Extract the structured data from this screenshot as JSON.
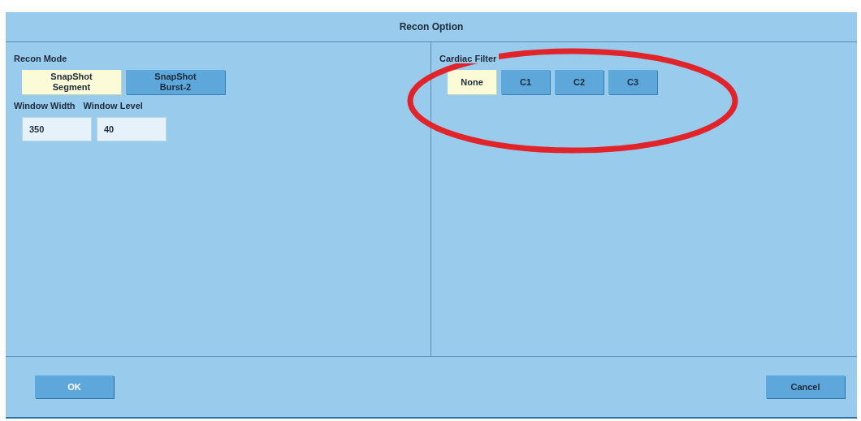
{
  "window": {
    "title": "Recon Option"
  },
  "recon_mode": {
    "label": "Recon Mode",
    "options": [
      {
        "label": "SnapShot\nSegment",
        "selected": true
      },
      {
        "label": "SnapShot\nBurst-2",
        "selected": false
      }
    ]
  },
  "fields": [
    {
      "label": "Window Width",
      "value": "350"
    },
    {
      "label": "Window Level",
      "value": "40"
    }
  ],
  "cardiac_filter": {
    "label": "Cardiac Filter",
    "options": [
      {
        "label": "None",
        "selected": true
      },
      {
        "label": "C1",
        "selected": false
      },
      {
        "label": "C2",
        "selected": false
      },
      {
        "label": "C3",
        "selected": false
      }
    ]
  },
  "buttons": [
    "OK",
    "Cancel"
  ]
}
